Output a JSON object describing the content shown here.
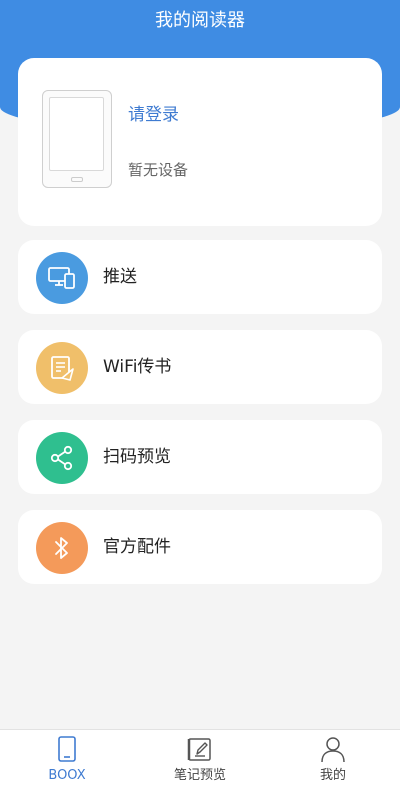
{
  "header": {
    "title": "我的阅读器"
  },
  "device": {
    "login_label": "请登录",
    "status_text": "暂无设备"
  },
  "menu": [
    {
      "label": "推送",
      "icon": "device-push-icon",
      "color": "#4a9be0"
    },
    {
      "label": "WiFi传书",
      "icon": "wifi-book-icon",
      "color": "#f0bf6a"
    },
    {
      "label": "扫码预览",
      "icon": "share-icon",
      "color": "#2fbf8f"
    },
    {
      "label": "官方配件",
      "icon": "bluetooth-icon",
      "color": "#f49a5a"
    }
  ],
  "bottom_nav": [
    {
      "label": "BOOX",
      "icon": "tablet-icon",
      "active": true
    },
    {
      "label": "笔记预览",
      "icon": "note-edit-icon",
      "active": false
    },
    {
      "label": "我的",
      "icon": "user-icon",
      "active": false
    }
  ],
  "colors": {
    "accent": "#3f8ce3",
    "active_tab": "#3f7bd1",
    "background": "#f4f4f4"
  }
}
